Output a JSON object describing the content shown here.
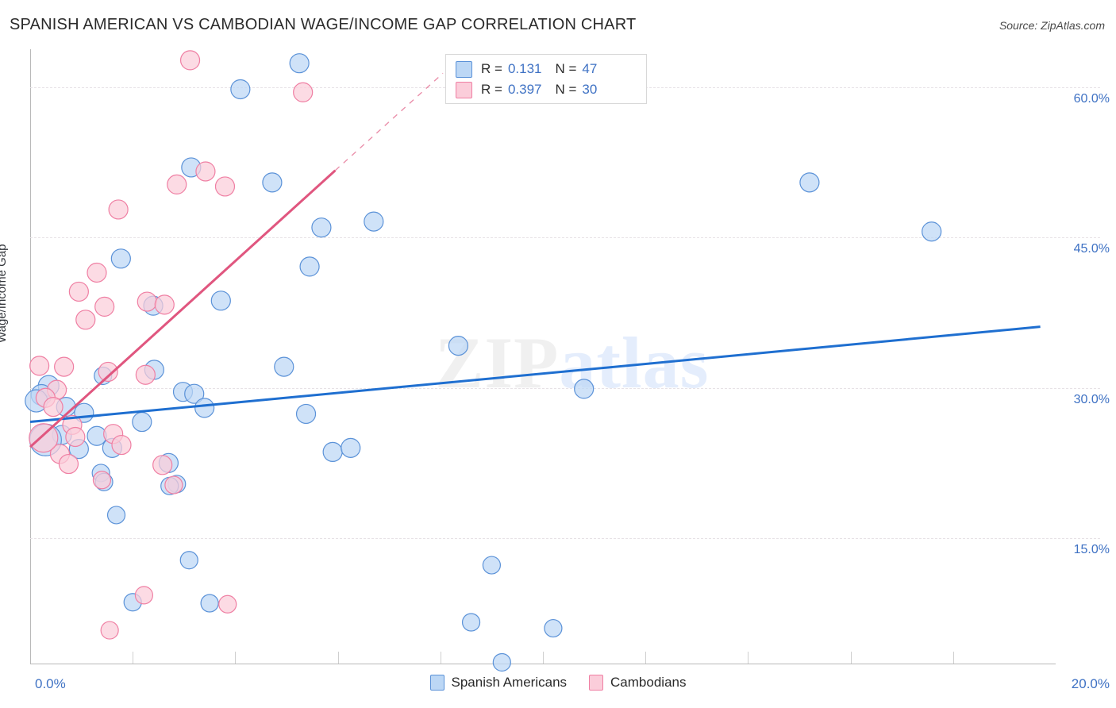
{
  "header": {
    "title": "SPANISH AMERICAN VS CAMBODIAN WAGE/INCOME GAP CORRELATION CHART",
    "source": "Source: ZipAtlas.com"
  },
  "watermark": {
    "part1": "ZIP",
    "part2": "atlas"
  },
  "stats": {
    "blue": {
      "r_label": "R =",
      "r_value": "0.131",
      "n_label": "N =",
      "n_value": "47",
      "color": "#bcd7f5"
    },
    "pink": {
      "r_label": "R =",
      "r_value": "0.397",
      "n_label": "N =",
      "n_value": "30",
      "color": "#fbcdda"
    }
  },
  "legend": {
    "items": [
      {
        "label": "Spanish Americans",
        "color": "#bcd7f5"
      },
      {
        "label": "Cambodians",
        "color": "#fbcdda"
      }
    ]
  },
  "chart_data": {
    "type": "scatter",
    "title": "SPANISH AMERICAN VS CAMBODIAN WAGE/INCOME GAP CORRELATION CHART",
    "xlabel": "",
    "ylabel": "Wage/Income Gap",
    "xlim": [
      0.0,
      20.0
    ],
    "ylim": [
      2.4,
      63.8
    ],
    "x_unit": "%",
    "y_unit": "%",
    "grid": true,
    "legend_position": "bottom-center",
    "xticks": [
      "0.0%",
      "20.0%"
    ],
    "yticks": [
      "60.0%",
      "45.0%",
      "30.0%",
      "15.0%"
    ],
    "ytick_values": [
      60.0,
      45.0,
      30.0,
      15.0
    ],
    "series": [
      {
        "name": "Spanish Americans",
        "color": "#bcd7f5",
        "edge": "#5b92d8",
        "r": 0.131,
        "n": 47,
        "trend": {
          "x0": 0.0,
          "y0": 26.6,
          "x1": 19.7,
          "y1": 36.1,
          "style": "solid",
          "color": "#1f6fd0"
        },
        "points": [
          {
            "x": 5.25,
            "y": 62.4,
            "r": 12
          },
          {
            "x": 4.1,
            "y": 59.8,
            "r": 12
          },
          {
            "x": 3.14,
            "y": 52.0,
            "r": 12
          },
          {
            "x": 4.72,
            "y": 50.5,
            "r": 12
          },
          {
            "x": 6.7,
            "y": 46.6,
            "r": 12
          },
          {
            "x": 5.68,
            "y": 46.0,
            "r": 12
          },
          {
            "x": 15.2,
            "y": 50.5,
            "r": 12
          },
          {
            "x": 17.58,
            "y": 45.6,
            "r": 12
          },
          {
            "x": 1.77,
            "y": 42.9,
            "r": 12
          },
          {
            "x": 5.45,
            "y": 42.1,
            "r": 12
          },
          {
            "x": 3.72,
            "y": 38.7,
            "r": 12
          },
          {
            "x": 2.4,
            "y": 38.2,
            "r": 12
          },
          {
            "x": 8.35,
            "y": 34.2,
            "r": 12
          },
          {
            "x": 4.95,
            "y": 32.1,
            "r": 12
          },
          {
            "x": 2.42,
            "y": 31.8,
            "r": 12
          },
          {
            "x": 1.42,
            "y": 31.2,
            "r": 11
          },
          {
            "x": 10.8,
            "y": 29.9,
            "r": 12
          },
          {
            "x": 2.98,
            "y": 29.6,
            "r": 12
          },
          {
            "x": 3.2,
            "y": 29.4,
            "r": 12
          },
          {
            "x": 0.36,
            "y": 30.2,
            "r": 13
          },
          {
            "x": 0.22,
            "y": 29.3,
            "r": 13
          },
          {
            "x": 0.7,
            "y": 28.1,
            "r": 12
          },
          {
            "x": 1.05,
            "y": 27.5,
            "r": 12
          },
          {
            "x": 3.4,
            "y": 28.0,
            "r": 12
          },
          {
            "x": 5.38,
            "y": 27.4,
            "r": 12
          },
          {
            "x": 2.18,
            "y": 26.6,
            "r": 12
          },
          {
            "x": 0.62,
            "y": 25.3,
            "r": 12
          },
          {
            "x": 1.6,
            "y": 24.0,
            "r": 12
          },
          {
            "x": 5.9,
            "y": 23.6,
            "r": 12
          },
          {
            "x": 6.25,
            "y": 24.0,
            "r": 12
          },
          {
            "x": 2.7,
            "y": 22.5,
            "r": 12
          },
          {
            "x": 1.38,
            "y": 21.5,
            "r": 11
          },
          {
            "x": 1.44,
            "y": 20.6,
            "r": 11
          },
          {
            "x": 2.86,
            "y": 20.4,
            "r": 11
          },
          {
            "x": 2.72,
            "y": 20.2,
            "r": 11
          },
          {
            "x": 1.68,
            "y": 17.3,
            "r": 11
          },
          {
            "x": 3.1,
            "y": 12.8,
            "r": 11
          },
          {
            "x": 9.0,
            "y": 12.3,
            "r": 11
          },
          {
            "x": 2.0,
            "y": 8.6,
            "r": 11
          },
          {
            "x": 3.5,
            "y": 8.5,
            "r": 11
          },
          {
            "x": 8.6,
            "y": 6.6,
            "r": 11
          },
          {
            "x": 10.2,
            "y": 6.0,
            "r": 11
          },
          {
            "x": 9.2,
            "y": 2.6,
            "r": 11
          },
          {
            "x": 0.12,
            "y": 28.7,
            "r": 14
          },
          {
            "x": 0.3,
            "y": 24.8,
            "r": 20
          },
          {
            "x": 1.3,
            "y": 25.2,
            "r": 12
          },
          {
            "x": 0.95,
            "y": 23.9,
            "r": 12
          }
        ]
      },
      {
        "name": "Cambodians",
        "color": "#fbcdda",
        "edge": "#ef7fa3",
        "r": 0.397,
        "n": 30,
        "trend": {
          "x0": 0.0,
          "y0": 24.1,
          "x1": 5.95,
          "y1": 51.7,
          "style": "solid",
          "color": "#e0567f",
          "dash_x1": 8.05,
          "dash_y1": 61.4
        },
        "points": [
          {
            "x": 3.12,
            "y": 62.7,
            "r": 12
          },
          {
            "x": 5.32,
            "y": 59.5,
            "r": 12
          },
          {
            "x": 3.42,
            "y": 51.6,
            "r": 12
          },
          {
            "x": 2.86,
            "y": 50.3,
            "r": 12
          },
          {
            "x": 3.8,
            "y": 50.1,
            "r": 12
          },
          {
            "x": 1.72,
            "y": 47.8,
            "r": 12
          },
          {
            "x": 1.3,
            "y": 41.5,
            "r": 12
          },
          {
            "x": 0.95,
            "y": 39.6,
            "r": 12
          },
          {
            "x": 2.28,
            "y": 38.6,
            "r": 12
          },
          {
            "x": 1.45,
            "y": 38.1,
            "r": 12
          },
          {
            "x": 2.62,
            "y": 38.3,
            "r": 12
          },
          {
            "x": 1.08,
            "y": 36.8,
            "r": 12
          },
          {
            "x": 0.18,
            "y": 32.2,
            "r": 12
          },
          {
            "x": 0.66,
            "y": 32.1,
            "r": 12
          },
          {
            "x": 1.52,
            "y": 31.6,
            "r": 12
          },
          {
            "x": 2.25,
            "y": 31.3,
            "r": 12
          },
          {
            "x": 0.52,
            "y": 29.8,
            "r": 12
          },
          {
            "x": 0.3,
            "y": 29.0,
            "r": 12
          },
          {
            "x": 0.45,
            "y": 28.1,
            "r": 12
          },
          {
            "x": 0.82,
            "y": 26.3,
            "r": 12
          },
          {
            "x": 0.88,
            "y": 25.1,
            "r": 12
          },
          {
            "x": 1.62,
            "y": 25.4,
            "r": 12
          },
          {
            "x": 1.78,
            "y": 24.3,
            "r": 12
          },
          {
            "x": 0.58,
            "y": 23.4,
            "r": 12
          },
          {
            "x": 0.75,
            "y": 22.4,
            "r": 12
          },
          {
            "x": 2.58,
            "y": 22.3,
            "r": 12
          },
          {
            "x": 1.4,
            "y": 20.8,
            "r": 11
          },
          {
            "x": 2.8,
            "y": 20.3,
            "r": 11
          },
          {
            "x": 2.22,
            "y": 9.3,
            "r": 11
          },
          {
            "x": 3.85,
            "y": 8.4,
            "r": 11
          },
          {
            "x": 1.55,
            "y": 5.8,
            "r": 11
          },
          {
            "x": 0.26,
            "y": 25.0,
            "r": 18
          }
        ]
      }
    ]
  }
}
